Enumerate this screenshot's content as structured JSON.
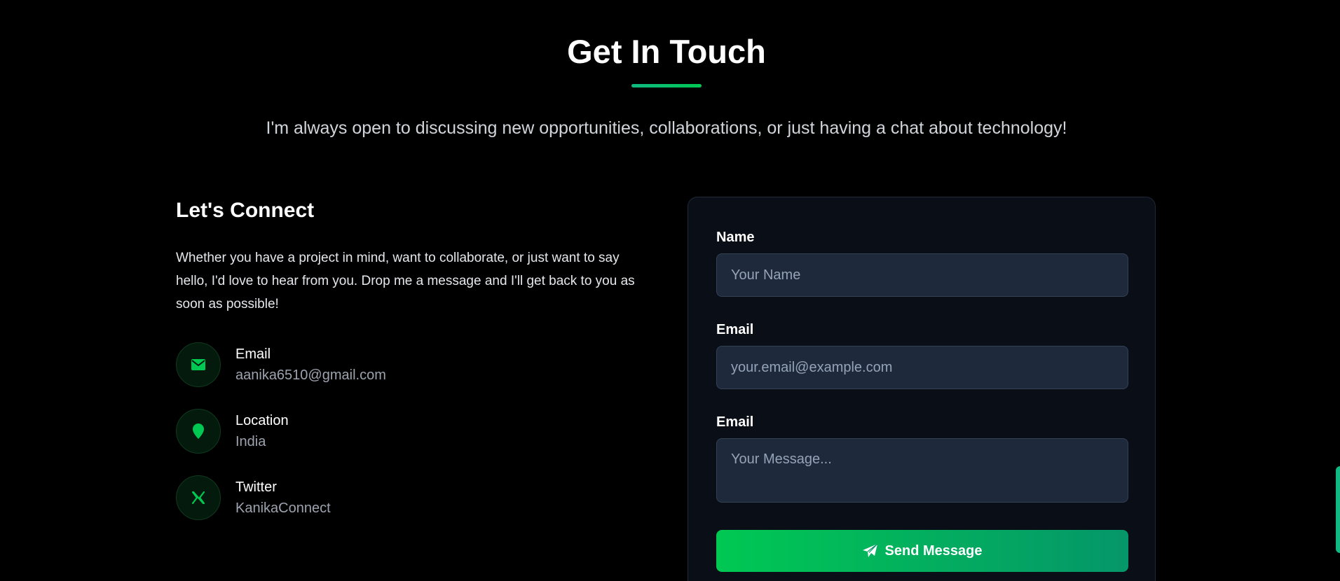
{
  "header": {
    "title": "Get In Touch",
    "subtitle": "I'm always open to discussing new opportunities, collaborations, or just having a chat about technology!"
  },
  "connect": {
    "title": "Let's Connect",
    "text": "Whether you have a project in mind, want to collaborate, or just want to say hello, I'd love to hear from you. Drop me a message and I'll get back to you as soon as possible!",
    "items": [
      {
        "icon": "envelope-icon",
        "label": "Email",
        "value": "aanika6510@gmail.com"
      },
      {
        "icon": "map-pin-icon",
        "label": "Location",
        "value": "India"
      },
      {
        "icon": "x-twitter-icon",
        "label": "Twitter",
        "value": "KanikaConnect"
      }
    ]
  },
  "form": {
    "name_label": "Name",
    "name_placeholder": "Your Name",
    "email_label": "Email",
    "email_placeholder": "your.email@example.com",
    "message_label": "Email",
    "message_placeholder": "Your Message...",
    "send_label": "Send Message"
  },
  "colors": {
    "accent": "#00c853",
    "accent_dark": "#059669",
    "background": "#000000",
    "card": "#0a0e16",
    "input": "#1e293b"
  }
}
